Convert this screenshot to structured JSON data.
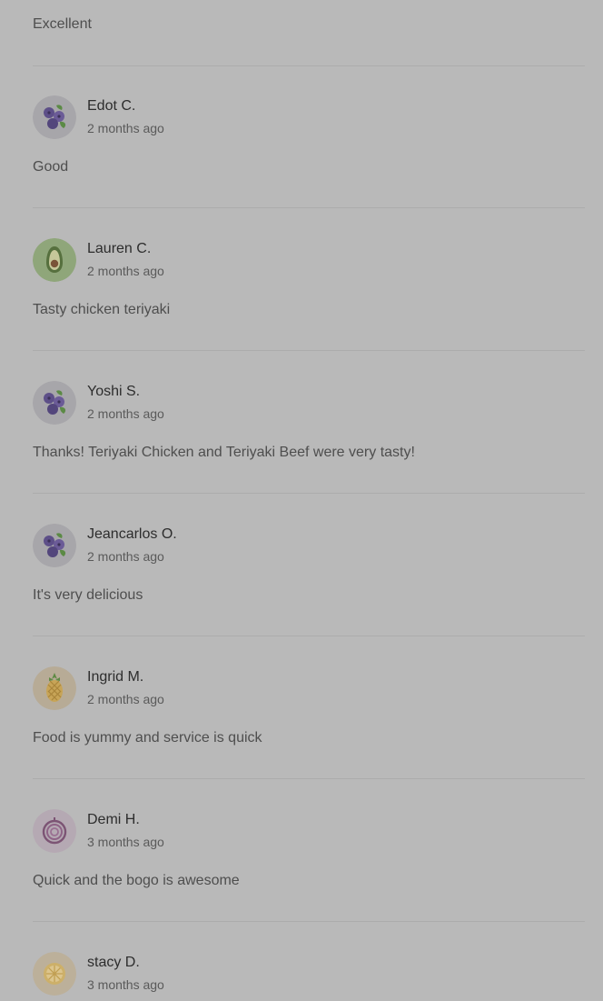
{
  "top_comment": "Excellent",
  "reviews": [
    {
      "name": "Edot C.",
      "time": "2 months ago",
      "comment": "Good",
      "avatar": "blueberry-icon"
    },
    {
      "name": "Lauren C.",
      "time": "2 months ago",
      "comment": "Tasty chicken teriyaki",
      "avatar": "avocado-icon"
    },
    {
      "name": "Yoshi S.",
      "time": "2 months ago",
      "comment": "Thanks! Teriyaki Chicken and Teriyaki Beef were very tasty!",
      "avatar": "blueberry-icon"
    },
    {
      "name": "Jeancarlos O.",
      "time": "2 months ago",
      "comment": "It's very delicious",
      "avatar": "blueberry-icon"
    },
    {
      "name": "Ingrid M.",
      "time": "2 months ago",
      "comment": "Food is yummy and service is quick",
      "avatar": "pineapple-icon"
    },
    {
      "name": "Demi H.",
      "time": "3 months ago",
      "comment": "Quick and the bogo is awesome",
      "avatar": "onion-icon"
    },
    {
      "name": "stacy D.",
      "time": "3 months ago",
      "comment": "",
      "avatar": "lemon-icon"
    }
  ]
}
